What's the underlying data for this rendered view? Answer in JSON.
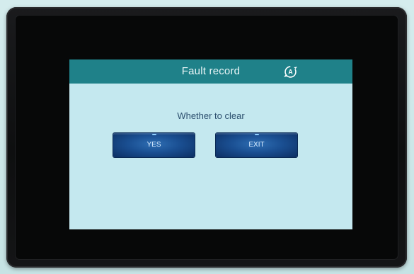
{
  "screen": {
    "title": "Fault record",
    "auto_icon": "auto-rotate-icon",
    "prompt": "Whether to clear",
    "yes_label": "YES",
    "exit_label": "EXIT"
  },
  "colors": {
    "titlebar": "#1f8189",
    "screen_bg": "#c4e8ef",
    "button": "#1a4f92",
    "bezel": "#0e0f10"
  }
}
